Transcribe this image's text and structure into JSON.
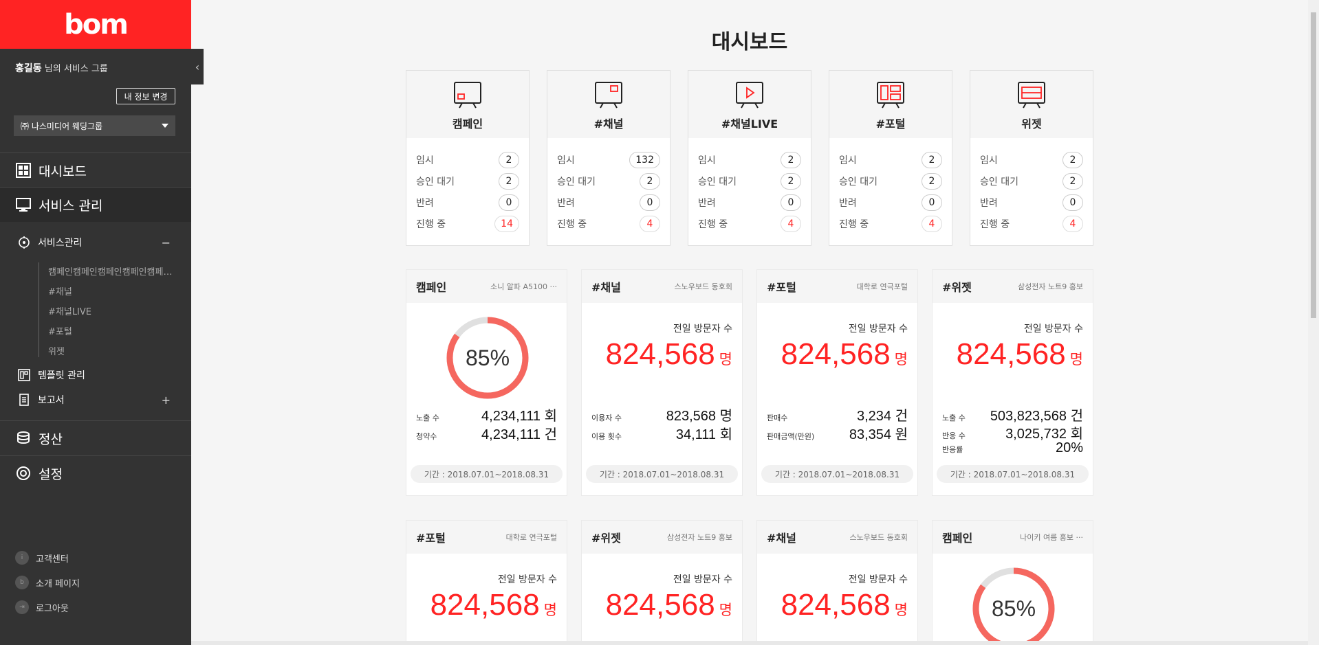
{
  "sidebar": {
    "logo": "bom",
    "user_name": "홍길동",
    "user_suffix": " 님의 서비스 그룹",
    "myinfo_button": "내 정보 변경",
    "group_select": "㈜ 나스미디어 웨딩그룹",
    "nav": {
      "dashboard": "대시보드",
      "service_mgmt": "서비스 관리",
      "service_sub": "서비스관리",
      "service_sub_sign": "−",
      "template_mgmt": "템플릿 관리",
      "report": "보고서",
      "report_sign": "+",
      "settlement": "정산",
      "settings": "설정"
    },
    "tree": [
      "캠페인캠페인캠페인캠페인캠페인캠페인",
      "#채널",
      "#채널LIVE",
      "#포털",
      "위젯"
    ],
    "footer": {
      "support": "고객센터",
      "intro": "소개 페이지",
      "logout": "로그아웃"
    }
  },
  "page_title": "대시보드",
  "status_labels": {
    "temp": "임시",
    "pending": "승인 대기",
    "rejected": "반려",
    "active": "진행 중"
  },
  "status_cards": [
    {
      "label": "캠페인",
      "temp": "2",
      "pending": "2",
      "rejected": "0",
      "active": "14"
    },
    {
      "label": "#채널",
      "temp": "132",
      "pending": "2",
      "rejected": "0",
      "active": "4"
    },
    {
      "label": "#채널LIVE",
      "temp": "2",
      "pending": "2",
      "rejected": "0",
      "active": "4"
    },
    {
      "label": "#포털",
      "temp": "2",
      "pending": "2",
      "rejected": "0",
      "active": "4"
    },
    {
      "label": "위젯",
      "temp": "2",
      "pending": "2",
      "rejected": "0",
      "active": "4"
    }
  ],
  "stat_cards": {
    "r1c1": {
      "title": "캠페인",
      "subtitle": "소니 알파 A5100 ···",
      "percent_label": "85%",
      "percent": 85,
      "m1_label": "노출 수",
      "m1_value": "4,234,111 회",
      "m2_label": "청약수",
      "m2_value": "4,234,111 건",
      "period": "기간 : 2018.07.01~2018.08.31"
    },
    "r1c2": {
      "title": "#채널",
      "subtitle": "스노우보드 동호회",
      "visits_label": "전일 방문자 수",
      "visits": "824,568",
      "unit": "명",
      "m1_label": "이용자 수",
      "m1_value": "823,568 명",
      "m2_label": "이용 횟수",
      "m2_value": "34,111 회",
      "period": "기간 : 2018.07.01~2018.08.31"
    },
    "r1c3": {
      "title": "#포털",
      "subtitle": "대학로 연극포털",
      "visits_label": "전일 방문자 수",
      "visits": "824,568",
      "unit": "명",
      "m1_label": "판매수",
      "m1_value": "3,234 건",
      "m2_label": "판매금액(만원)",
      "m2_value": "83,354 원",
      "period": "기간 : 2018.07.01~2018.08.31"
    },
    "r1c4": {
      "title": "#위젯",
      "subtitle": "삼성전자 노트9 홍보",
      "visits_label": "전일 방문자 수",
      "visits": "824,568",
      "unit": "명",
      "m1_label": "노출 수",
      "m1_value": "503,823,568 건",
      "m2_label": "반응 수",
      "m2_value": "3,025,732 회",
      "m3_label": "반응률",
      "m3_value": "20%",
      "period": "기간 : 2018.07.01~2018.08.31"
    },
    "r2c1": {
      "title": "#포털",
      "subtitle": "대학로 연극포털",
      "visits_label": "전일 방문자 수",
      "visits": "824,568",
      "unit": "명"
    },
    "r2c2": {
      "title": "#위젯",
      "subtitle": "삼성전자 노트9 홍보",
      "visits_label": "전일 방문자 수",
      "visits": "824,568",
      "unit": "명"
    },
    "r2c3": {
      "title": "#채널",
      "subtitle": "스노우보드 동호회",
      "visits_label": "전일 방문자 수",
      "visits": "824,568",
      "unit": "명"
    },
    "r2c4": {
      "title": "캠페인",
      "subtitle": "나이키 여름 홍보 ···",
      "percent_label": "85%",
      "percent": 85
    }
  },
  "colors": {
    "brand": "#ff2323",
    "sidebar_bg": "#333333",
    "donut_track": "#e0e0e0",
    "donut_fill": "#f5675f"
  }
}
